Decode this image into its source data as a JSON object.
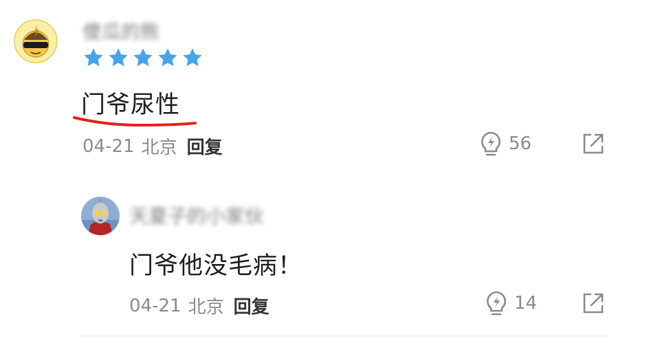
{
  "comment": {
    "username": "傻瓜的熊",
    "rating_stars": 5,
    "rating_color": "#4aa3e8",
    "text": "门爷尿性",
    "underline_color": "#e0231a",
    "date": "04-21",
    "location": "北京",
    "reply_label": "回复",
    "like_count": "56",
    "like_icon": "lightbulb-icon",
    "share_icon": "share-icon"
  },
  "reply": {
    "username": "天夏子的小家伙",
    "text": "门爷他没毛病！",
    "date": "04-21",
    "location": "北京",
    "reply_label": "回复",
    "like_count": "14",
    "like_icon": "lightbulb-icon",
    "share_icon": "share-icon"
  }
}
